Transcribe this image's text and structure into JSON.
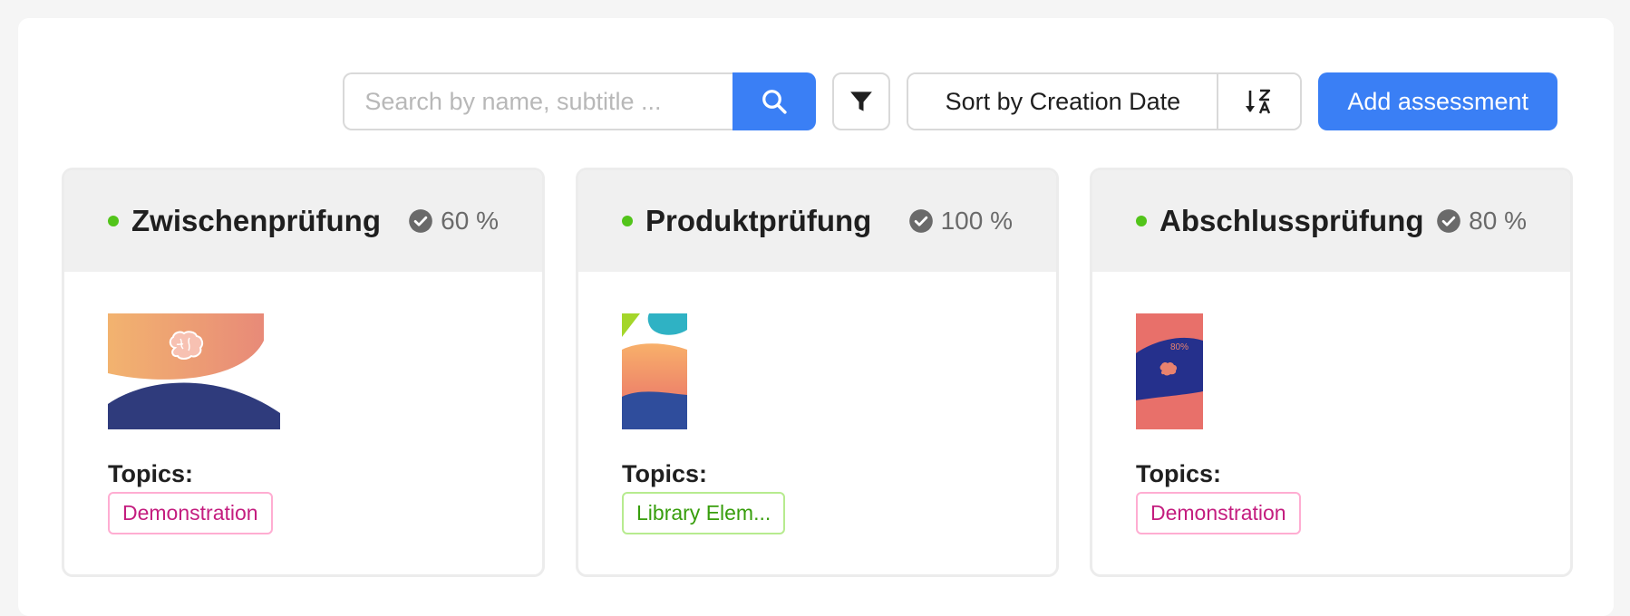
{
  "toolbar": {
    "search_placeholder": "Search by name, subtitle ...",
    "search_icon": "search-icon",
    "filter_icon": "filter-icon",
    "sort_label": "Sort by Creation Date",
    "sort_order_icon": "sort-z-a-icon",
    "add_label": "Add assessment"
  },
  "colors": {
    "primary": "#3a7ff5",
    "status_active": "#52c41a",
    "tag_pink": "#c41d7f",
    "tag_green": "#389e0d"
  },
  "cards": [
    {
      "title": "Zwischenprüfung",
      "score": "60 %",
      "score_icon": "check-circle-icon",
      "topics_label": "Topics:",
      "tag": "Demonstration"
    },
    {
      "title": "Produktprüfung",
      "score": "100 %",
      "score_icon": "check-circle-icon",
      "topics_label": "Topics:",
      "tag": "Library Elem..."
    },
    {
      "title": "Abschlussprüfung",
      "score": "80 %",
      "score_icon": "check-circle-icon",
      "topics_label": "Topics:",
      "tag": "Demonstration",
      "thumb_text": "80%"
    }
  ]
}
